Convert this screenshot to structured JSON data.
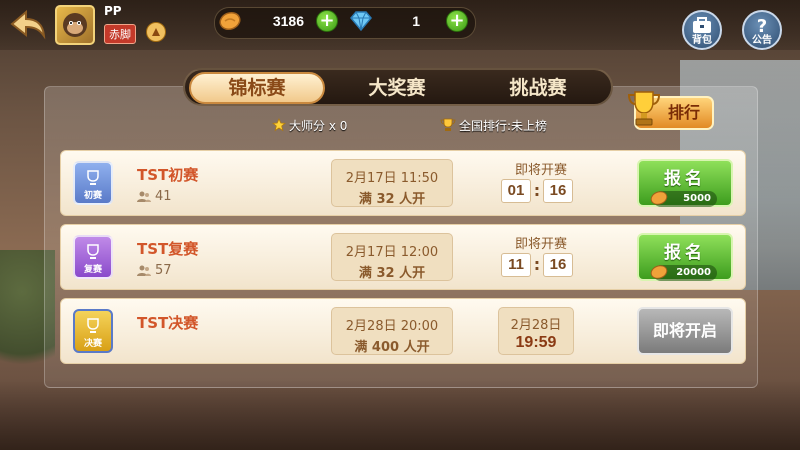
{
  "user": {
    "name": "PP",
    "title": "赤脚"
  },
  "currency": {
    "beans": "3186",
    "diamonds": "1"
  },
  "buttons": {
    "bag": "背包",
    "notice": "公告",
    "rank": "排行"
  },
  "tabs": [
    {
      "label": "锦标赛",
      "active": true
    },
    {
      "label": "大奖赛",
      "active": false
    },
    {
      "label": "挑战赛",
      "active": false
    }
  ],
  "stats": {
    "master_points": "大师分 x 0",
    "national_rank": "全国排行:未上榜"
  },
  "matches": [
    {
      "name": "TST初赛",
      "card_label": "初赛",
      "players": "41",
      "date": "2月17日 11:50",
      "condition": "满 32 人开",
      "countdown_label": "即将开赛",
      "countdown": [
        "01",
        "16"
      ],
      "signup_label": "报名",
      "fee": "5000",
      "card_color": "#6f8fd8"
    },
    {
      "name": "TST复赛",
      "card_label": "复赛",
      "players": "57",
      "date": "2月17日 12:00",
      "condition": "满 32 人开",
      "countdown_label": "即将开赛",
      "countdown": [
        "11",
        "16"
      ],
      "signup_label": "报名",
      "fee": "20000",
      "card_color": "#9b5ad6"
    },
    {
      "name": "TST决赛",
      "card_label": "决赛",
      "date": "2月28日 20:00",
      "condition": "满 400 人开",
      "start_date": "2月28日",
      "start_time": "19:59",
      "status_label": "即将开启",
      "card_color": "#e8b92a"
    }
  ],
  "colors": {
    "accent_green": "#3d9d1e",
    "name_orange": "#d2562a",
    "tab_active": "#f1c98b"
  }
}
